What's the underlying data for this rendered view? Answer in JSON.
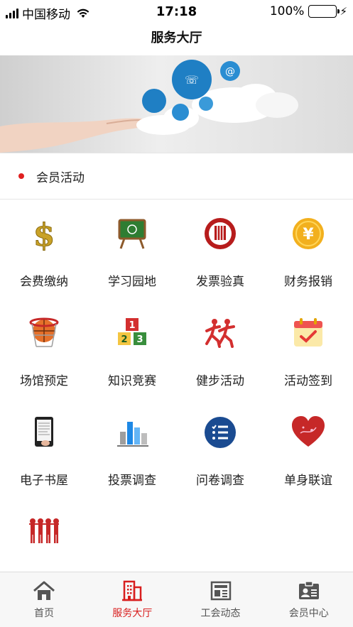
{
  "status_bar": {
    "carrier": "中国移动",
    "time": "17:18",
    "battery_text": "100%"
  },
  "nav": {
    "title": "服务大厅"
  },
  "section": {
    "title": "会员活动"
  },
  "grid_items": [
    {
      "label": "会费缴纳",
      "icon": "dollar-sign-icon"
    },
    {
      "label": "学习园地",
      "icon": "chalkboard-icon"
    },
    {
      "label": "发票验真",
      "icon": "seal-emblem-icon"
    },
    {
      "label": "财务报销",
      "icon": "yen-coin-icon"
    },
    {
      "label": "场馆预定",
      "icon": "basketball-hoop-icon"
    },
    {
      "label": "知识竞赛",
      "icon": "number-blocks-icon"
    },
    {
      "label": "健步活动",
      "icon": "runners-icon"
    },
    {
      "label": "活动签到",
      "icon": "calendar-check-icon"
    },
    {
      "label": "电子书屋",
      "icon": "ebook-reader-icon"
    },
    {
      "label": "投票调查",
      "icon": "bar-chart-3d-icon"
    },
    {
      "label": "问卷调查",
      "icon": "checklist-icon"
    },
    {
      "label": "单身联谊",
      "icon": "heart-icon"
    },
    {
      "label": "",
      "icon": "group-people-icon"
    }
  ],
  "tabs": [
    {
      "label": "首页",
      "icon": "home-icon",
      "active": false
    },
    {
      "label": "服务大厅",
      "icon": "building-icon",
      "active": true
    },
    {
      "label": "工会动态",
      "icon": "newspaper-icon",
      "active": false
    },
    {
      "label": "会员中心",
      "icon": "member-card-icon",
      "active": false
    }
  ],
  "colors": {
    "accent": "#d81e1e",
    "battery": "#4cd964",
    "dot": "#e02020"
  }
}
